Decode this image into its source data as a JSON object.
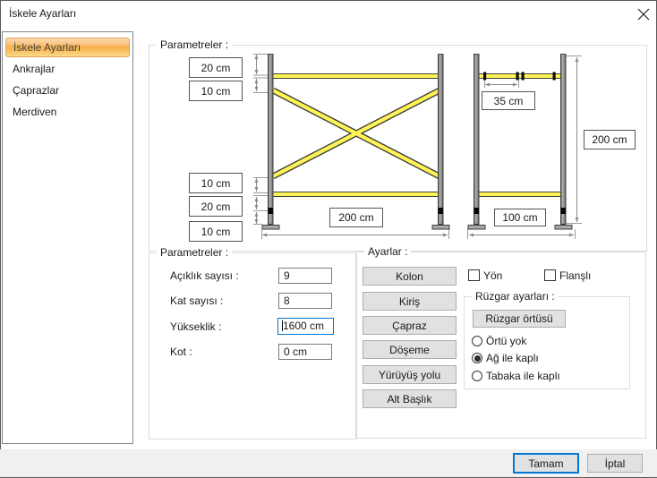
{
  "window": {
    "title": "İskele Ayarları",
    "close_icon": "✕"
  },
  "sidebar": {
    "items": [
      {
        "label": "İskele Ayarları",
        "selected": true
      },
      {
        "label": "Ankrajlar",
        "selected": false
      },
      {
        "label": "Çaprazlar",
        "selected": false
      },
      {
        "label": "Merdiven",
        "selected": false
      }
    ]
  },
  "diagram": {
    "group_label": "Parametreler :",
    "dim_boxes": [
      "20 cm",
      "10 cm",
      "10 cm",
      "20 cm",
      "10 cm",
      "200 cm",
      "35 cm",
      "200 cm",
      "100 cm"
    ]
  },
  "parameters": {
    "group_label": "Parametreler :",
    "fields": [
      {
        "label": "Açıklık sayısı :",
        "value": "9"
      },
      {
        "label": "Kat sayısı :",
        "value": "8"
      },
      {
        "label": "Yükseklik :",
        "value": "1600 cm",
        "focused": true
      },
      {
        "label": "Kot :",
        "value": "0 cm"
      }
    ]
  },
  "settings": {
    "group_label": "Ayarlar :",
    "buttons": [
      "Kolon",
      "Kiriş",
      "Çapraz",
      "Döşeme",
      "Yürüyüş yolu",
      "Alt Başlık"
    ],
    "checkboxes": [
      {
        "label": "Yön",
        "checked": false
      },
      {
        "label": "Flanşlı",
        "checked": false
      }
    ],
    "wind": {
      "group_label": "Rüzgar ayarları :",
      "button": "Rüzgar örtüsü",
      "radios": [
        {
          "label": "Örtü yok",
          "selected": false
        },
        {
          "label": "Ağ ile kaplı",
          "selected": true
        },
        {
          "label": "Tabaka ile kaplı",
          "selected": false
        }
      ]
    }
  },
  "footer": {
    "ok": "Tamam",
    "cancel": "İptal"
  },
  "colors": {
    "accent": "#0078d7",
    "selection_orange": "#f9b450",
    "rail_yellow": "#fff455",
    "button_face": "#e1e1e1"
  }
}
